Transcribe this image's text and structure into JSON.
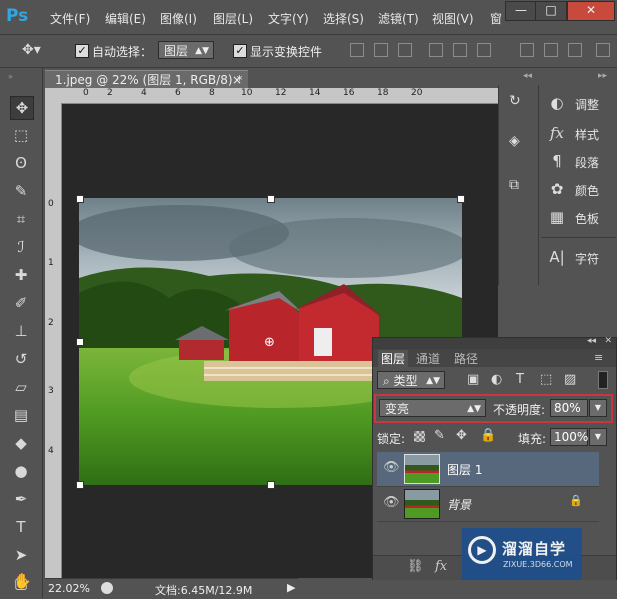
{
  "app": {
    "logo": "Ps"
  },
  "menu": [
    "文件(F)",
    "编辑(E)",
    "图像(I)",
    "图层(L)",
    "文字(Y)",
    "选择(S)",
    "滤镜(T)",
    "视图(V)",
    "窗"
  ],
  "window_controls": {
    "minimize": "—",
    "maximize": "□",
    "close": "✕"
  },
  "options": {
    "auto_select_label": "自动选择：",
    "auto_select_value": "图层",
    "show_transform_label": "显示变换控件"
  },
  "document": {
    "tab_title": "1.jpeg @ 22% (图层 1, RGB/8) *",
    "tab_close": "×",
    "ruler_top": [
      "0",
      "2",
      "4",
      "6",
      "8",
      "10",
      "12",
      "14",
      "16",
      "18",
      "20"
    ],
    "ruler_left": [
      "0",
      "1",
      "2",
      "3",
      "4"
    ]
  },
  "status": {
    "zoom": "22.02%",
    "doc_info": "文档:6.45M/12.9M"
  },
  "right_panel": [
    {
      "label": "调整",
      "icon": "adjustments-icon"
    },
    {
      "label": "样式",
      "icon": "styles-icon"
    },
    {
      "label": "段落",
      "icon": "paragraph-icon"
    },
    {
      "label": "颜色",
      "icon": "color-icon"
    },
    {
      "label": "色板",
      "icon": "swatches-icon"
    },
    {
      "label": "字符",
      "icon": "character-icon"
    }
  ],
  "layers_panel": {
    "tabs": [
      "图层",
      "通道",
      "路径"
    ],
    "filter_kind": "类型",
    "blend_mode": "变亮",
    "opacity_label": "不透明度:",
    "opacity_value": "80%",
    "lock_label": "锁定:",
    "fill_label": "填充:",
    "fill_value": "100%",
    "layers": [
      {
        "name": "图层 1",
        "selected": true
      },
      {
        "name": "背景",
        "selected": false
      }
    ]
  },
  "watermark": {
    "cn": "溜溜自学",
    "url": "ZIXUE.3D66.COM"
  },
  "colors": {
    "accent_highlight": "#c8373d",
    "selected_layer": "#58687c",
    "canvas_bg": "#282828"
  }
}
